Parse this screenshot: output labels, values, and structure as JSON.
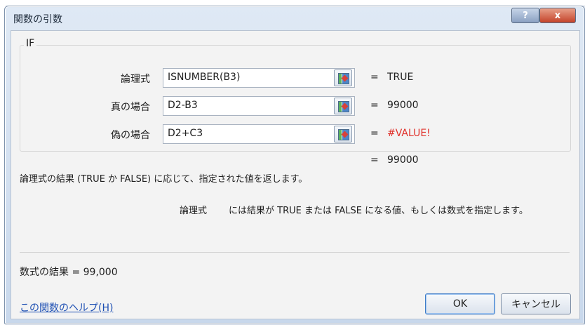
{
  "dialog": {
    "title": "関数の引数",
    "help_glyph": "?",
    "close_glyph": "x"
  },
  "function": {
    "name": "IF",
    "args": [
      {
        "label": "論理式",
        "value": "ISNUMBER(B3)",
        "eq": "=",
        "result": "TRUE"
      },
      {
        "label": "真の場合",
        "value": "D2-B3",
        "eq": "=",
        "result": "99000"
      },
      {
        "label": "偽の場合",
        "value": "D2+C3",
        "eq": "=",
        "result": "#VALUE!"
      }
    ],
    "overall_eq": "=",
    "overall_result": "99000"
  },
  "description": {
    "main": "論理式の結果 (TRUE か FALSE) に応じて、指定された値を返します。",
    "arg_name": "論理式",
    "arg_text": "には結果が TRUE または FALSE になる値、もしくは数式を指定します。"
  },
  "footer": {
    "formula_result": "数式の結果 =  99,000",
    "help_link": "この関数のヘルプ(H)",
    "ok_label": "OK",
    "cancel_label": "キャンセル"
  },
  "colors": {
    "error_text": "#e0302a",
    "link": "#1d4fb3",
    "close_button": "#c4432a"
  },
  "icons": {
    "ref_button": "range-select-icon"
  }
}
